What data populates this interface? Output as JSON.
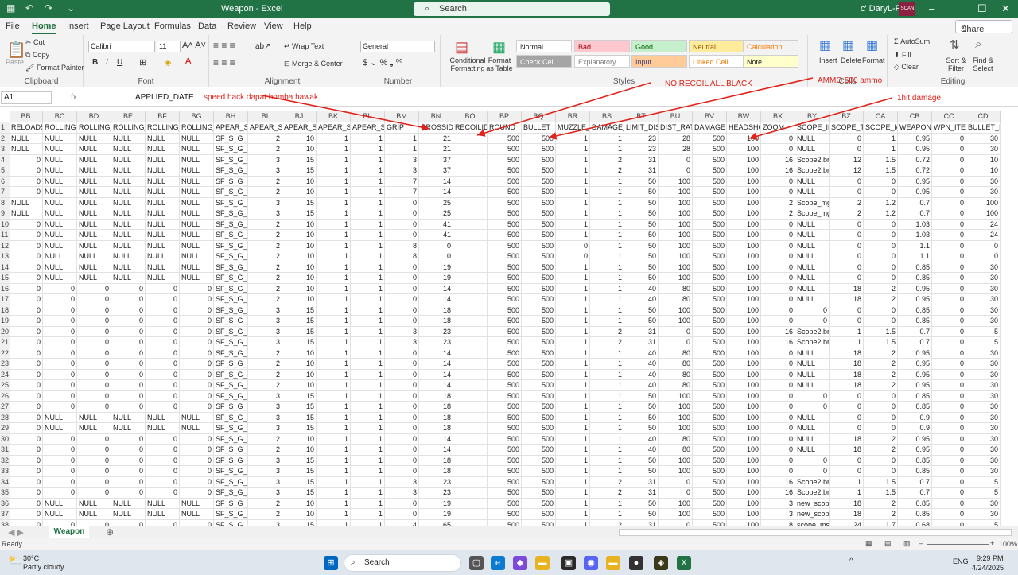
{
  "window": {
    "title": "Weapon  -  Excel",
    "search_label": "Search",
    "user": "c' DaryL-Po",
    "avatar_text": "SCAN",
    "min": "–",
    "restore": "☐",
    "close": "✕"
  },
  "tabs": [
    {
      "label": "File"
    },
    {
      "label": "Home",
      "active": true
    },
    {
      "label": "Insert"
    },
    {
      "label": "Page Layout"
    },
    {
      "label": "Formulas"
    },
    {
      "label": "Data"
    },
    {
      "label": "Review"
    },
    {
      "label": "View"
    },
    {
      "label": "Help"
    }
  ],
  "share_label": "Share",
  "ribbon": {
    "clipboard": {
      "paste": "Paste",
      "cut": "Cut",
      "copy": "Copy",
      "format_painter": "Format Painter",
      "group": "Clipboard"
    },
    "font": {
      "name": "Calibri",
      "size": "11",
      "bold": "B",
      "italic": "I",
      "underline": "U",
      "group": "Font"
    },
    "alignment": {
      "wrap": "Wrap Text",
      "merge": "Merge & Center",
      "group": "Alignment"
    },
    "number": {
      "format": "General",
      "group": "Number"
    },
    "styles": {
      "conditional": "Conditional Formatting",
      "format_as_table": "Format as Table",
      "group": "Styles",
      "cells": [
        {
          "label": "Normal",
          "bg": "#ffffff",
          "fg": "#222"
        },
        {
          "label": "Bad",
          "bg": "#ffc7ce",
          "fg": "#9c0006"
        },
        {
          "label": "Good",
          "bg": "#c6efce",
          "fg": "#006100"
        },
        {
          "label": "Neutral",
          "bg": "#ffeb9c",
          "fg": "#9c5700"
        },
        {
          "label": "Calculation",
          "bg": "#f2f2f2",
          "fg": "#fa7d00"
        },
        {
          "label": "Check Cell",
          "bg": "#a5a5a5",
          "fg": "#ffffff"
        },
        {
          "label": "Explanatory ...",
          "bg": "#ffffff",
          "fg": "#7f7f7f"
        },
        {
          "label": "Input",
          "bg": "#ffcc99",
          "fg": "#3f3f76"
        },
        {
          "label": "Linked Cell",
          "bg": "#ffffff",
          "fg": "#fa7d00"
        },
        {
          "label": "Note",
          "bg": "#ffffcc",
          "fg": "#222"
        }
      ]
    },
    "cells_group": {
      "insert": "Insert",
      "delete": "Delete",
      "format": "Format",
      "group": "Cells"
    },
    "editing": {
      "autosum": "AutoSum",
      "fill": "Fill",
      "clear": "Clear",
      "sort": "Sort & Filter",
      "find": "Find & Select",
      "group": "Editing"
    }
  },
  "formula_bar": {
    "name_box": "A1",
    "fx": "fx",
    "value": "APPLIED_DATE"
  },
  "annotations": [
    {
      "text": "speed hack dapat bomba hawak"
    },
    {
      "text": "NO RECOIL ALL BLACK"
    },
    {
      "text": "AMMO 500 ammo"
    },
    {
      "text": "1hit damage"
    }
  ],
  "columns": [
    "BB",
    "BC",
    "BD",
    "BE",
    "BF",
    "BG",
    "BH",
    "BI",
    "BJ",
    "BK",
    "BL",
    "BM",
    "BN",
    "BO",
    "BP",
    "BQ",
    "BR",
    "BS",
    "BT",
    "BU",
    "BV",
    "BW",
    "BX",
    "BY",
    "BZ",
    "CA",
    "CB",
    "CC",
    "CD"
  ],
  "headers": [
    "RELOAD5",
    "ROLLING_",
    "ROLLING_",
    "ROLLING_",
    "ROLLING_",
    "ROLLING_",
    "APEAR_SC",
    "APEAR_SN",
    "APEAR_SN",
    "APEAR_SN",
    "APEAR_SN",
    "GRIP",
    "CROSSID",
    "RECOILID",
    "ROUND",
    "BULLET",
    "MUZZLE_",
    "DAMAGE_",
    "LIMIT_DIS",
    "DIST_RATI",
    "DAMAGE",
    "HEADSHO",
    "ZOOM",
    "SCOPE_IM",
    "SCOPE_TY",
    "SCOPE_M",
    "WEAPON_",
    "WPN_ITEM",
    "BULLET_IN"
  ],
  "rows": [
    [
      2,
      "NULL",
      "NULL",
      "NULL",
      "NULL",
      "NULL",
      "NULL",
      "SF_S_G_FA",
      "2",
      "10",
      "1",
      "1",
      "1",
      "21",
      "",
      "500",
      "500",
      "1",
      "1",
      "23",
      "28",
      "500",
      "100",
      "0",
      "NULL",
      "0",
      "1",
      "0.95",
      "0",
      "30"
    ],
    [
      3,
      "NULL",
      "NULL",
      "NULL",
      "NULL",
      "NULL",
      "NULL",
      "SF_S_G_FA",
      "2",
      "10",
      "1",
      "1",
      "1",
      "21",
      "",
      "500",
      "500",
      "1",
      "1",
      "23",
      "28",
      "500",
      "100",
      "0",
      "NULL",
      "0",
      "1",
      "0.95",
      "0",
      "30"
    ],
    [
      4,
      "0",
      "NULL",
      "NULL",
      "NULL",
      "NULL",
      "NULL",
      "SF_S_G_M",
      "3",
      "15",
      "1",
      "1",
      "3",
      "37",
      "",
      "500",
      "500",
      "1",
      "2",
      "31",
      "0",
      "500",
      "100",
      "16",
      "Scope2.br",
      "12",
      "1.5",
      "0.72",
      "0",
      "10"
    ],
    [
      5,
      "0",
      "NULL",
      "NULL",
      "NULL",
      "NULL",
      "NULL",
      "SF_S_G_M",
      "3",
      "15",
      "1",
      "1",
      "3",
      "37",
      "",
      "500",
      "500",
      "1",
      "2",
      "31",
      "0",
      "500",
      "100",
      "16",
      "Scope2.br",
      "12",
      "1.5",
      "0.72",
      "0",
      "10"
    ],
    [
      6,
      "0",
      "NULL",
      "NULL",
      "NULL",
      "NULL",
      "NULL",
      "SF_S_G_ru",
      "2",
      "10",
      "1",
      "1",
      "7",
      "14",
      "",
      "500",
      "500",
      "1",
      "1",
      "50",
      "100",
      "500",
      "100",
      "0",
      "NULL",
      "0",
      "0",
      "0.95",
      "0",
      "30"
    ],
    [
      7,
      "0",
      "NULL",
      "NULL",
      "NULL",
      "NULL",
      "NULL",
      "SF_S_G_ru",
      "2",
      "10",
      "1",
      "1",
      "7",
      "14",
      "",
      "500",
      "500",
      "1",
      "1",
      "50",
      "100",
      "500",
      "100",
      "0",
      "NULL",
      "0",
      "0",
      "0.95",
      "0",
      "30"
    ],
    [
      8,
      "NULL",
      "NULL",
      "NULL",
      "NULL",
      "NULL",
      "NULL",
      "SF_S_G_m",
      "3",
      "15",
      "1",
      "1",
      "0",
      "25",
      "",
      "500",
      "500",
      "1",
      "1",
      "50",
      "100",
      "500",
      "100",
      "2",
      "Scope_mg",
      "2",
      "1.2",
      "0.7",
      "0",
      "100"
    ],
    [
      9,
      "NULL",
      "NULL",
      "NULL",
      "NULL",
      "NULL",
      "NULL",
      "SF_S_G_m",
      "3",
      "15",
      "1",
      "1",
      "0",
      "25",
      "",
      "500",
      "500",
      "1",
      "1",
      "50",
      "100",
      "500",
      "100",
      "2",
      "Scope_mg",
      "2",
      "1.2",
      "0.7",
      "0",
      "100"
    ],
    [
      10,
      "0",
      "NULL",
      "NULL",
      "NULL",
      "NULL",
      "NULL",
      "SF_S_G_m",
      "2",
      "10",
      "1",
      "1",
      "0",
      "41",
      "",
      "500",
      "500",
      "1",
      "1",
      "50",
      "100",
      "500",
      "100",
      "0",
      "NULL",
      "0",
      "0",
      "1.03",
      "0",
      "24"
    ],
    [
      11,
      "0",
      "NULL",
      "NULL",
      "NULL",
      "NULL",
      "NULL",
      "SF_S_G_m",
      "2",
      "10",
      "1",
      "1",
      "0",
      "41",
      "",
      "500",
      "500",
      "1",
      "1",
      "50",
      "100",
      "500",
      "100",
      "0",
      "NULL",
      "0",
      "0",
      "1.03",
      "0",
      "24"
    ],
    [
      12,
      "0",
      "NULL",
      "NULL",
      "NULL",
      "NULL",
      "NULL",
      "SF_S_G_xr",
      "2",
      "10",
      "1",
      "1",
      "8",
      "0",
      "",
      "500",
      "500",
      "0",
      "1",
      "50",
      "100",
      "500",
      "100",
      "0",
      "NULL",
      "0",
      "0",
      "1.1",
      "0",
      "0"
    ],
    [
      13,
      "0",
      "NULL",
      "NULL",
      "NULL",
      "NULL",
      "NULL",
      "SF_S_G_xr",
      "2",
      "10",
      "1",
      "1",
      "8",
      "0",
      "",
      "500",
      "500",
      "0",
      "1",
      "50",
      "100",
      "500",
      "100",
      "0",
      "NULL",
      "0",
      "0",
      "1.1",
      "0",
      "0"
    ],
    [
      14,
      "0",
      "NULL",
      "NULL",
      "NULL",
      "NULL",
      "NULL",
      "SF_S_G_ar",
      "2",
      "10",
      "1",
      "1",
      "0",
      "19",
      "",
      "500",
      "500",
      "1",
      "1",
      "50",
      "100",
      "500",
      "100",
      "0",
      "NULL",
      "0",
      "0",
      "0.85",
      "0",
      "30"
    ],
    [
      15,
      "0",
      "NULL",
      "NULL",
      "NULL",
      "NULL",
      "NULL",
      "SF_S_G_ar",
      "2",
      "10",
      "1",
      "1",
      "0",
      "19",
      "",
      "500",
      "500",
      "1",
      "1",
      "50",
      "100",
      "500",
      "100",
      "0",
      "NULL",
      "0",
      "0",
      "0.85",
      "0",
      "30"
    ],
    [
      16,
      "0",
      "0",
      "0",
      "0",
      "0",
      "0",
      "SF_S_G_M",
      "2",
      "10",
      "1",
      "1",
      "0",
      "14",
      "",
      "500",
      "500",
      "1",
      "1",
      "40",
      "80",
      "500",
      "100",
      "0",
      "NULL",
      "18",
      "2",
      "0.95",
      "0",
      "30"
    ],
    [
      17,
      "0",
      "0",
      "0",
      "0",
      "0",
      "0",
      "SF_S_G_M",
      "2",
      "10",
      "1",
      "1",
      "0",
      "14",
      "",
      "500",
      "500",
      "1",
      "1",
      "40",
      "80",
      "500",
      "100",
      "0",
      "NULL",
      "18",
      "2",
      "0.95",
      "0",
      "30"
    ],
    [
      18,
      "0",
      "0",
      "0",
      "0",
      "0",
      "0",
      "SF_S_G_ak",
      "3",
      "15",
      "1",
      "1",
      "0",
      "18",
      "",
      "500",
      "500",
      "1",
      "1",
      "50",
      "100",
      "500",
      "100",
      "0",
      "0",
      "0",
      "0",
      "0.85",
      "0",
      "30"
    ],
    [
      19,
      "0",
      "0",
      "0",
      "0",
      "0",
      "0",
      "SF_S_G_ak",
      "3",
      "15",
      "1",
      "1",
      "0",
      "18",
      "",
      "500",
      "500",
      "1",
      "1",
      "50",
      "100",
      "500",
      "100",
      "0",
      "0",
      "0",
      "0",
      "0.85",
      "0",
      "30"
    ],
    [
      20,
      "0",
      "0",
      "0",
      "0",
      "0",
      "0",
      "SF_S_G_P:",
      "3",
      "15",
      "1",
      "1",
      "3",
      "23",
      "",
      "500",
      "500",
      "1",
      "2",
      "31",
      "0",
      "500",
      "100",
      "16",
      "Scope2.br",
      "1",
      "1.5",
      "0.7",
      "0",
      "5"
    ],
    [
      21,
      "0",
      "0",
      "0",
      "0",
      "0",
      "0",
      "SF_S_G_P:",
      "3",
      "15",
      "1",
      "1",
      "3",
      "23",
      "",
      "500",
      "500",
      "1",
      "2",
      "31",
      "0",
      "500",
      "100",
      "16",
      "Scope2.br",
      "1",
      "1.5",
      "0.7",
      "0",
      "5"
    ],
    [
      22,
      "0",
      "0",
      "0",
      "0",
      "0",
      "0",
      "SF_S_G_M",
      "2",
      "10",
      "1",
      "1",
      "0",
      "14",
      "",
      "500",
      "500",
      "1",
      "1",
      "40",
      "80",
      "500",
      "100",
      "0",
      "NULL",
      "18",
      "2",
      "0.95",
      "0",
      "30"
    ],
    [
      23,
      "0",
      "0",
      "0",
      "0",
      "0",
      "0",
      "SF_S_G_M",
      "2",
      "10",
      "1",
      "1",
      "0",
      "14",
      "",
      "500",
      "500",
      "1",
      "1",
      "40",
      "80",
      "500",
      "100",
      "0",
      "NULL",
      "18",
      "2",
      "0.95",
      "0",
      "30"
    ],
    [
      24,
      "0",
      "0",
      "0",
      "0",
      "0",
      "0",
      "SF_S_G_M",
      "2",
      "10",
      "1",
      "1",
      "0",
      "14",
      "",
      "500",
      "500",
      "1",
      "1",
      "40",
      "80",
      "500",
      "100",
      "0",
      "NULL",
      "18",
      "2",
      "0.95",
      "0",
      "30"
    ],
    [
      25,
      "0",
      "0",
      "0",
      "0",
      "0",
      "0",
      "SF_S_G_M",
      "2",
      "10",
      "1",
      "1",
      "0",
      "14",
      "",
      "500",
      "500",
      "1",
      "1",
      "40",
      "80",
      "500",
      "100",
      "0",
      "NULL",
      "18",
      "2",
      "0.95",
      "0",
      "30"
    ],
    [
      26,
      "0",
      "0",
      "0",
      "0",
      "0",
      "0",
      "SF_S_G_ak",
      "3",
      "15",
      "1",
      "1",
      "0",
      "18",
      "",
      "500",
      "500",
      "1",
      "1",
      "50",
      "100",
      "500",
      "100",
      "0",
      "0",
      "0",
      "0",
      "0.85",
      "0",
      "30"
    ],
    [
      27,
      "0",
      "0",
      "0",
      "0",
      "0",
      "0",
      "SF_S_G_ak",
      "3",
      "15",
      "1",
      "1",
      "0",
      "18",
      "",
      "500",
      "500",
      "1",
      "1",
      "50",
      "100",
      "500",
      "100",
      "0",
      "0",
      "0",
      "0",
      "0.85",
      "0",
      "30"
    ],
    [
      28,
      "0",
      "NULL",
      "NULL",
      "NULL",
      "NULL",
      "NULL",
      "SF_S_G_ak",
      "3",
      "15",
      "1",
      "1",
      "0",
      "18",
      "",
      "500",
      "500",
      "1",
      "1",
      "50",
      "100",
      "500",
      "100",
      "0",
      "NULL",
      "0",
      "0",
      "0.9",
      "0",
      "30"
    ],
    [
      29,
      "0",
      "NULL",
      "NULL",
      "NULL",
      "NULL",
      "NULL",
      "SF_S_G_ak",
      "3",
      "15",
      "1",
      "1",
      "0",
      "18",
      "",
      "500",
      "500",
      "1",
      "1",
      "50",
      "100",
      "500",
      "100",
      "0",
      "NULL",
      "0",
      "0",
      "0.9",
      "0",
      "30"
    ],
    [
      30,
      "0",
      "0",
      "0",
      "0",
      "0",
      "0",
      "SF_S_G_M",
      "2",
      "10",
      "1",
      "1",
      "0",
      "14",
      "",
      "500",
      "500",
      "1",
      "1",
      "40",
      "80",
      "500",
      "100",
      "0",
      "NULL",
      "18",
      "2",
      "0.95",
      "0",
      "30"
    ],
    [
      31,
      "0",
      "0",
      "0",
      "0",
      "0",
      "0",
      "SF_S_G_M",
      "2",
      "10",
      "1",
      "1",
      "0",
      "14",
      "",
      "500",
      "500",
      "1",
      "1",
      "40",
      "80",
      "500",
      "100",
      "0",
      "NULL",
      "18",
      "2",
      "0.95",
      "0",
      "30"
    ],
    [
      32,
      "0",
      "0",
      "0",
      "0",
      "0",
      "0",
      "SF_S_G_ak",
      "3",
      "15",
      "1",
      "1",
      "0",
      "18",
      "",
      "500",
      "500",
      "1",
      "1",
      "50",
      "100",
      "500",
      "100",
      "0",
      "0",
      "0",
      "0",
      "0.85",
      "0",
      "30"
    ],
    [
      33,
      "0",
      "0",
      "0",
      "0",
      "0",
      "0",
      "SF_S_G_ak",
      "3",
      "15",
      "1",
      "1",
      "0",
      "18",
      "",
      "500",
      "500",
      "1",
      "1",
      "50",
      "100",
      "500",
      "100",
      "0",
      "0",
      "0",
      "0",
      "0.85",
      "0",
      "30"
    ],
    [
      34,
      "0",
      "0",
      "0",
      "0",
      "0",
      "0",
      "SF_S_G_P:",
      "3",
      "15",
      "1",
      "1",
      "3",
      "23",
      "",
      "500",
      "500",
      "1",
      "2",
      "31",
      "0",
      "500",
      "100",
      "16",
      "Scope2.br",
      "1",
      "1.5",
      "0.7",
      "0",
      "5"
    ],
    [
      35,
      "0",
      "0",
      "0",
      "0",
      "0",
      "0",
      "SF_S_G_P:",
      "3",
      "15",
      "1",
      "1",
      "3",
      "23",
      "",
      "500",
      "500",
      "1",
      "2",
      "31",
      "0",
      "500",
      "100",
      "16",
      "Scope2.br",
      "1",
      "1.5",
      "0.7",
      "0",
      "5"
    ],
    [
      36,
      "0",
      "NULL",
      "NULL",
      "NULL",
      "NULL",
      "NULL",
      "SF_S_G_ar",
      "2",
      "10",
      "1",
      "1",
      "0",
      "19",
      "",
      "500",
      "500",
      "1",
      "1",
      "50",
      "100",
      "500",
      "100",
      "3",
      "new_scop",
      "18",
      "2",
      "0.85",
      "0",
      "30"
    ],
    [
      37,
      "0",
      "NULL",
      "NULL",
      "NULL",
      "NULL",
      "NULL",
      "SF_S_G_ar",
      "2",
      "10",
      "1",
      "1",
      "0",
      "19",
      "",
      "500",
      "500",
      "1",
      "1",
      "50",
      "100",
      "500",
      "100",
      "3",
      "new_scop",
      "18",
      "2",
      "0.85",
      "0",
      "30"
    ],
    [
      38,
      "0",
      "0",
      "0",
      "0",
      "0",
      "0",
      "SF_S_G_sv",
      "3",
      "15",
      "1",
      "1",
      "4",
      "65",
      "",
      "500",
      "500",
      "1",
      "2",
      "31",
      "0",
      "500",
      "100",
      "8",
      "scope_ms",
      "24",
      "1.7",
      "0.68",
      "0",
      "5"
    ]
  ],
  "sheet_tab": "Weapon",
  "status": {
    "ready": "Ready",
    "zoom": "100%"
  },
  "taskbar": {
    "weather_temp": "30°C",
    "weather_text": "Partly cloudy",
    "search": "Search",
    "time": "9:29 PM",
    "date": "4/24/2025",
    "lang": "ENG"
  }
}
